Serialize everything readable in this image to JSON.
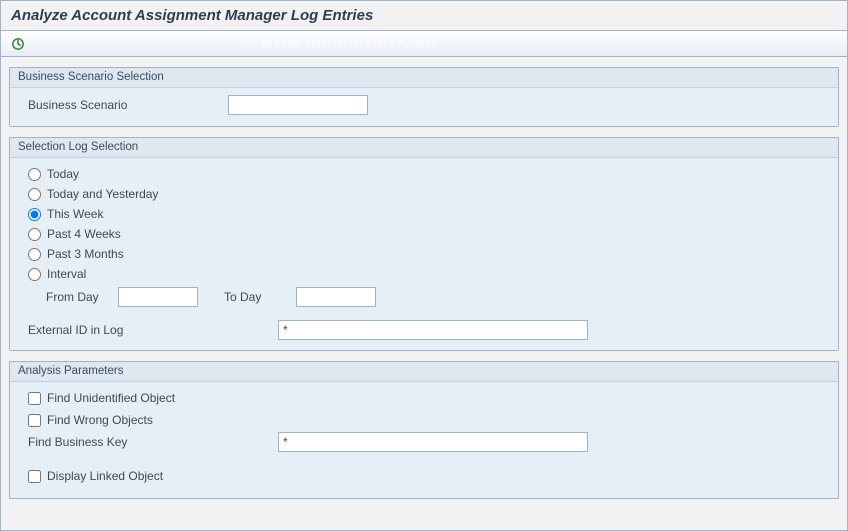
{
  "title": "Analyze Account Assignment Manager Log Entries",
  "watermark": "© www.tutorialkart.com",
  "toolbar": {
    "execute_icon": "execute-icon"
  },
  "businessScenarioSelection": {
    "title": "Business Scenario Selection",
    "businessScenarioLabel": "Business Scenario",
    "businessScenarioValue": ""
  },
  "selectionLogSelection": {
    "title": "Selection Log Selection",
    "options": [
      {
        "label": "Today",
        "value": "today",
        "checked": false
      },
      {
        "label": "Today and Yesterday",
        "value": "today_yest",
        "checked": false
      },
      {
        "label": "This Week",
        "value": "this_week",
        "checked": true
      },
      {
        "label": "Past 4 Weeks",
        "value": "p4w",
        "checked": false
      },
      {
        "label": "Past 3 Months",
        "value": "p3m",
        "checked": false
      },
      {
        "label": "Interval",
        "value": "interval",
        "checked": false
      }
    ],
    "fromDayLabel": "From Day",
    "fromDayValue": "",
    "toDayLabel": "To Day",
    "toDayValue": "",
    "externalIdLabel": "External ID in Log",
    "externalIdValue": "*"
  },
  "analysisParameters": {
    "title": "Analysis Parameters",
    "findUnidentifiedLabel": "Find Unidentified Object",
    "findUnidentifiedChecked": false,
    "findWrongLabel": "Find Wrong Objects",
    "findWrongChecked": false,
    "findBusinessKeyLabel": "Find Business Key",
    "findBusinessKeyValue": "*",
    "displayLinkedLabel": "Display Linked Object",
    "displayLinkedChecked": false
  }
}
